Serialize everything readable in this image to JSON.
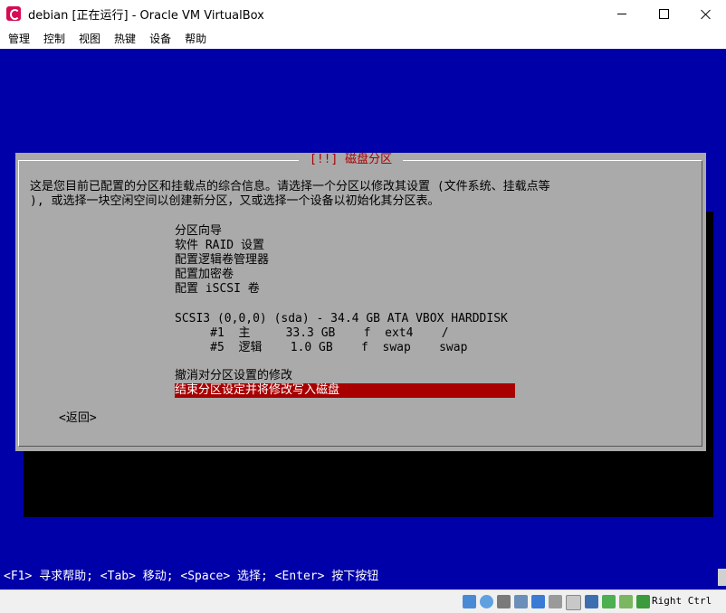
{
  "window": {
    "title": "debian [正在运行] - Oracle VM VirtualBox"
  },
  "menu": [
    "管理",
    "控制",
    "视图",
    "热键",
    "设备",
    "帮助"
  ],
  "dialog": {
    "title": "[!!] 磁盘分区",
    "intro_line1": "这是您目前已配置的分区和挂载点的综合信息。请选择一个分区以修改其设置 (文件系统、挂载点等",
    "intro_line2": "), 或选择一块空闲空间以创建新分区，又或选择一个设备以初始化其分区表。",
    "options": [
      "分区向导",
      "软件 RAID 设置",
      "配置逻辑卷管理器",
      "配置加密卷",
      "配置 iSCSI 卷"
    ],
    "disk": "SCSI3 (0,0,0) (sda) - 34.4 GB ATA VBOX HARDDISK",
    "partitions": [
      "     #1  主     33.3 GB    f  ext4    /",
      "     #5  逻辑    1.0 GB    f  swap    swap"
    ],
    "undo": "撤消对分区设置的修改",
    "finish": "结束分区设定并将修改写入磁盘",
    "back": "<返回>"
  },
  "help_line": "<F1> 寻求帮助; <Tab> 移动; <Space> 选择; <Enter> 按下按钮",
  "status_icons": [
    "hard-disk-icon",
    "optical-disk-icon",
    "usb-icon",
    "shared-folder-icon",
    "display-icon",
    "audio-icon",
    "network-icon",
    "video-capture-icon",
    "cpu-icon",
    "mouse-integration-icon",
    "keyboard-icon"
  ],
  "host_key": "Right Ctrl",
  "colors": {
    "screen_bg": "#0000a8",
    "dialog_bg": "#aaaaaa",
    "title_red": "#a80000",
    "selected_bg": "#a80000"
  }
}
